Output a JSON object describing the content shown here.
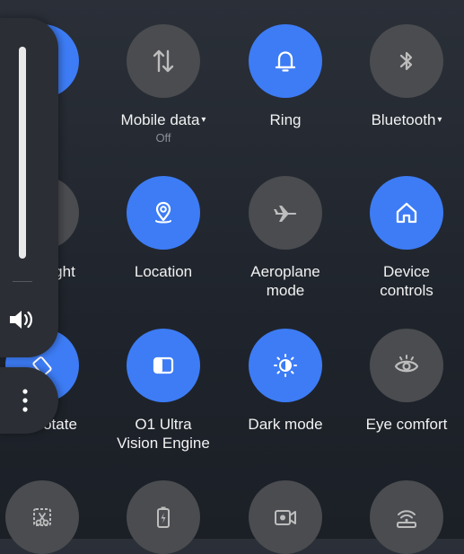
{
  "tiles": [
    {
      "label": "",
      "state": "on",
      "icon": "partial-tile-icon"
    },
    {
      "label": "Mobile data",
      "sublabel": "Off",
      "state": "off",
      "icon": "mobile-data-arrows-icon",
      "dropdown": true
    },
    {
      "label": "Ring",
      "state": "on",
      "icon": "bell-icon"
    },
    {
      "label": "Bluetooth",
      "state": "off",
      "icon": "bluetooth-icon",
      "dropdown": true
    },
    {
      "label": "ght",
      "state": "off",
      "icon": "flashlight-icon"
    },
    {
      "label": "Location",
      "state": "on",
      "icon": "location-pin-icon"
    },
    {
      "label_line1": "Aeroplane",
      "label_line2": "mode",
      "state": "off",
      "icon": "airplane-icon"
    },
    {
      "label_line1": "Device",
      "label_line2": "controls",
      "state": "on",
      "icon": "home-icon"
    },
    {
      "label": "otate",
      "state": "on",
      "icon": "auto-rotate-icon"
    },
    {
      "label_line1": "O1 Ultra",
      "label_line2": "Vision Engine",
      "state": "on",
      "icon": "vision-engine-icon"
    },
    {
      "label": "Dark mode",
      "state": "on",
      "icon": "dark-mode-icon"
    },
    {
      "label": "Eye comfort",
      "state": "off",
      "icon": "eye-icon"
    },
    {
      "state": "off",
      "icon": "screenshot-scissors-icon"
    },
    {
      "state": "off",
      "icon": "battery-saver-icon"
    },
    {
      "state": "off",
      "icon": "screen-record-icon"
    },
    {
      "state": "off",
      "icon": "wireless-hotspot-icon"
    }
  ],
  "caret": "▾",
  "volume": {
    "level": 1.0,
    "icon": "speaker-volume-icon"
  },
  "colors": {
    "on": "#3d7cf5",
    "off": "#4a4c50",
    "background": "#22272f"
  }
}
